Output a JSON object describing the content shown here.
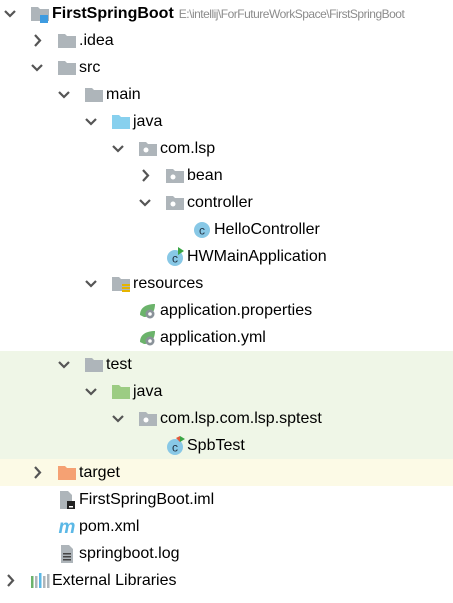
{
  "colors": {
    "folder": "#aeb5ba",
    "source_folder": "#87d0ee",
    "test_folder": "#9ccc83",
    "excluded_folder": "#f5a173",
    "class_icon": "#88c8e6",
    "test_background": "#eff6e7",
    "excluded_background": "#fcfae6"
  },
  "tree": [
    {
      "label": "FirstSpringBoot",
      "path": "E:\\intellij\\ForFutureWorkSpace\\FirstSpringBoot",
      "level": 0,
      "state": "expanded",
      "icon": "module-folder-icon",
      "bold": true
    },
    {
      "label": ".idea",
      "level": 1,
      "state": "collapsed",
      "icon": "folder-icon"
    },
    {
      "label": "src",
      "level": 1,
      "state": "expanded",
      "icon": "folder-icon"
    },
    {
      "label": "main",
      "level": 2,
      "state": "expanded",
      "icon": "folder-icon"
    },
    {
      "label": "java",
      "level": 3,
      "state": "expanded",
      "icon": "source-folder-icon"
    },
    {
      "label": "com.lsp",
      "level": 4,
      "state": "expanded",
      "icon": "package-icon"
    },
    {
      "label": "bean",
      "level": 5,
      "state": "collapsed",
      "icon": "package-icon"
    },
    {
      "label": "controller",
      "level": 5,
      "state": "expanded",
      "icon": "package-icon"
    },
    {
      "label": "HelloController",
      "level": 6,
      "state": "none",
      "icon": "class-icon"
    },
    {
      "label": "HWMainApplication",
      "level": 5,
      "state": "none",
      "icon": "runnable-class-icon"
    },
    {
      "label": "resources",
      "level": 3,
      "state": "expanded",
      "icon": "resources-folder-icon"
    },
    {
      "label": "application.properties",
      "level": 4,
      "state": "none",
      "icon": "spring-config-icon"
    },
    {
      "label": "application.yml",
      "level": 4,
      "state": "none",
      "icon": "spring-config-icon"
    },
    {
      "label": "test",
      "level": 2,
      "state": "expanded",
      "icon": "folder-icon",
      "bg": "test"
    },
    {
      "label": "java",
      "level": 3,
      "state": "expanded",
      "icon": "test-folder-icon",
      "bg": "test"
    },
    {
      "label": "com.lsp.com.lsp.sptest",
      "level": 4,
      "state": "expanded",
      "icon": "package-icon",
      "bg": "test"
    },
    {
      "label": "SpbTest",
      "level": 5,
      "state": "none",
      "icon": "test-class-icon",
      "bg": "test"
    },
    {
      "label": "target",
      "level": 1,
      "state": "collapsed",
      "icon": "excluded-folder-icon",
      "bg": "excluded"
    },
    {
      "label": "FirstSpringBoot.iml",
      "level": 1,
      "state": "none",
      "icon": "iml-file-icon"
    },
    {
      "label": "pom.xml",
      "level": 1,
      "state": "none",
      "icon": "maven-icon"
    },
    {
      "label": "springboot.log",
      "level": 1,
      "state": "none",
      "icon": "text-file-icon"
    },
    {
      "label": "External Libraries",
      "level": 0,
      "state": "collapsed",
      "icon": "libraries-icon"
    }
  ]
}
